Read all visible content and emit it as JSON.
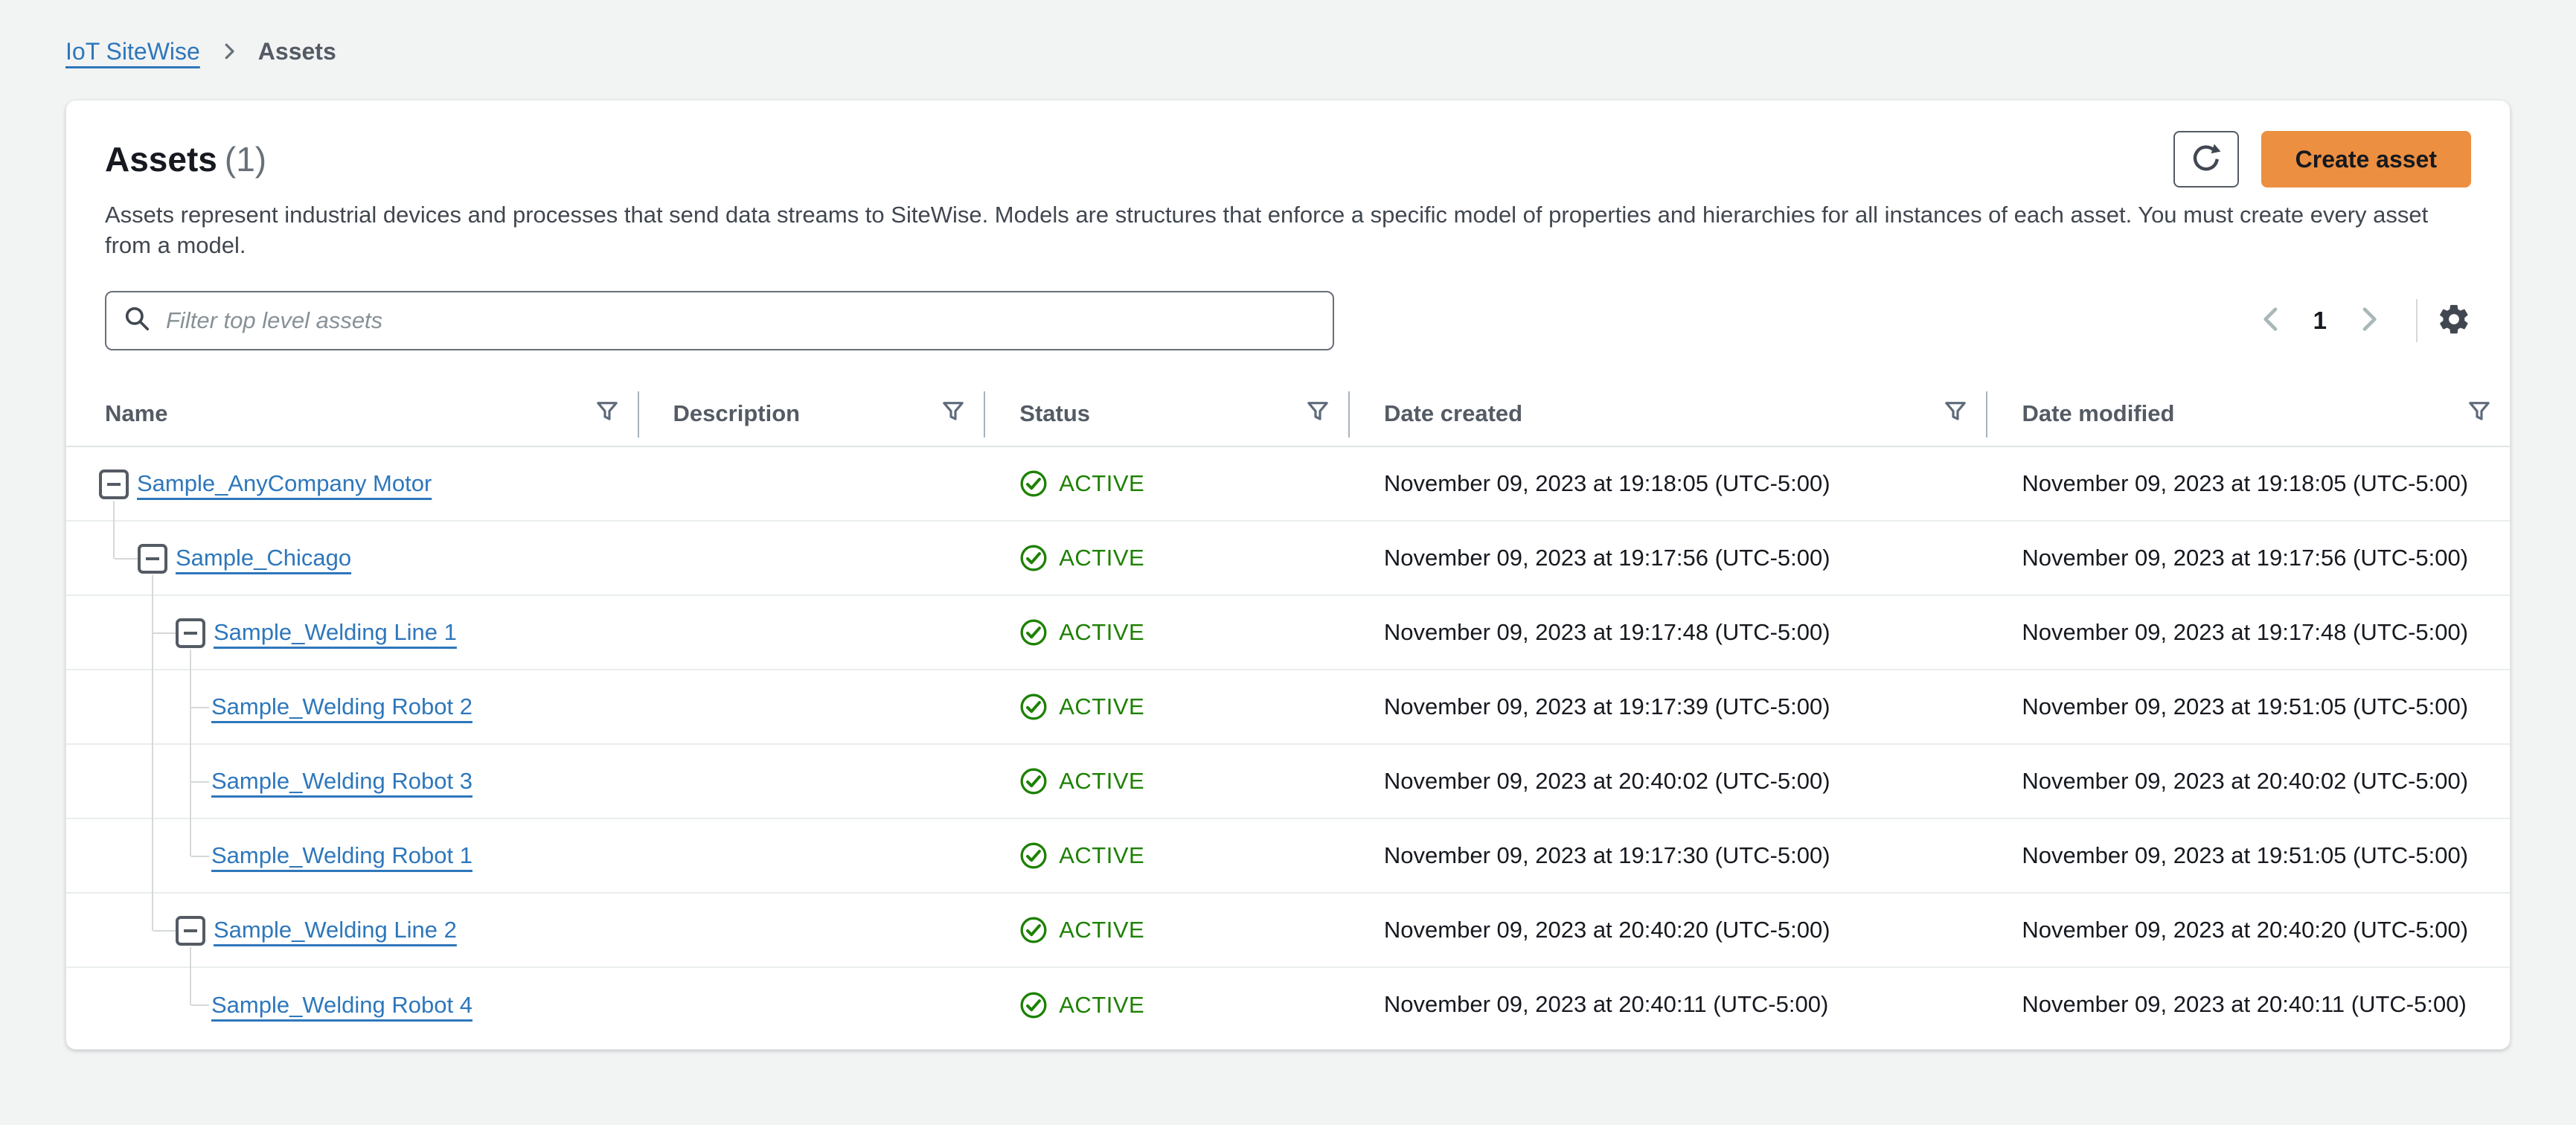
{
  "breadcrumb": {
    "items": [
      {
        "label": "IoT SiteWise",
        "type": "link"
      },
      {
        "label": "Assets",
        "type": "current"
      }
    ]
  },
  "header": {
    "title": "Assets",
    "count": "(1)",
    "description": "Assets represent industrial devices and processes that send data streams to SiteWise. Models are structures that enforce a specific model of properties and hierarchies for all instances of each asset. You must create every asset from a model.",
    "create_button_label": "Create asset"
  },
  "filter": {
    "placeholder": "Filter top level assets"
  },
  "pagination": {
    "current_page": "1"
  },
  "icons": {
    "search": "magnifier",
    "refresh": "circular-arrow",
    "settings": "gear",
    "filter": "funnel-down-triangle",
    "breadcrumb_separator": "chevron-right",
    "pagination_prev": "chevron-left",
    "pagination_next": "chevron-right",
    "tree_toggle_expanded": "minus-square",
    "status_active": "check-circle"
  },
  "colors": {
    "accent_orange": "#ec8f40",
    "link_blue": "#2e77bb",
    "status_green": "#1d8102"
  },
  "table": {
    "columns": [
      {
        "label": "Name"
      },
      {
        "label": "Description"
      },
      {
        "label": "Status"
      },
      {
        "label": "Date created"
      },
      {
        "label": "Date modified"
      }
    ],
    "rows": [
      {
        "name": "Sample_AnyCompany Motor",
        "depth": 0,
        "expandable": true,
        "description": "",
        "status": "ACTIVE",
        "date_created": "November 09, 2023 at 19:18:05 (UTC-5:00)",
        "date_modified": "November 09, 2023 at 19:18:05 (UTC-5:00)"
      },
      {
        "name": "Sample_Chicago",
        "depth": 1,
        "expandable": true,
        "description": "",
        "status": "ACTIVE",
        "date_created": "November 09, 2023 at 19:17:56 (UTC-5:00)",
        "date_modified": "November 09, 2023 at 19:17:56 (UTC-5:00)"
      },
      {
        "name": "Sample_Welding Line 1",
        "depth": 2,
        "expandable": true,
        "description": "",
        "status": "ACTIVE",
        "date_created": "November 09, 2023 at 19:17:48 (UTC-5:00)",
        "date_modified": "November 09, 2023 at 19:17:48 (UTC-5:00)"
      },
      {
        "name": "Sample_Welding Robot 2",
        "depth": 3,
        "expandable": false,
        "description": "",
        "status": "ACTIVE",
        "date_created": "November 09, 2023 at 19:17:39 (UTC-5:00)",
        "date_modified": "November 09, 2023 at 19:51:05 (UTC-5:00)"
      },
      {
        "name": "Sample_Welding Robot 3",
        "depth": 3,
        "expandable": false,
        "description": "",
        "status": "ACTIVE",
        "date_created": "November 09, 2023 at 20:40:02 (UTC-5:00)",
        "date_modified": "November 09, 2023 at 20:40:02 (UTC-5:00)"
      },
      {
        "name": "Sample_Welding Robot 1",
        "depth": 3,
        "expandable": false,
        "description": "",
        "status": "ACTIVE",
        "date_created": "November 09, 2023 at 19:17:30 (UTC-5:00)",
        "date_modified": "November 09, 2023 at 19:51:05 (UTC-5:00)"
      },
      {
        "name": "Sample_Welding Line 2",
        "depth": 2,
        "expandable": true,
        "description": "",
        "status": "ACTIVE",
        "date_created": "November 09, 2023 at 20:40:20 (UTC-5:00)",
        "date_modified": "November 09, 2023 at 20:40:20 (UTC-5:00)"
      },
      {
        "name": "Sample_Welding Robot 4",
        "depth": 3,
        "expandable": false,
        "description": "",
        "status": "ACTIVE",
        "date_created": "November 09, 2023 at 20:40:11 (UTC-5:00)",
        "date_modified": "November 09, 2023 at 20:40:11 (UTC-5:00)"
      }
    ]
  }
}
